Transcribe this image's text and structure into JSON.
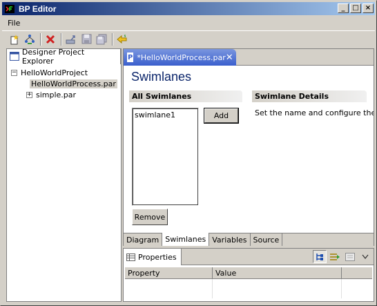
{
  "window": {
    "title": "BP Editor",
    "min": "_",
    "max": "□",
    "close": "×"
  },
  "menu": [
    "File"
  ],
  "explorer": {
    "tab_label": "Designer Project Explorer",
    "tree": {
      "project": "HelloWorldProject",
      "children": [
        "HelloWorldProcess.par",
        "simple.par"
      ]
    },
    "expand_minus": "−",
    "expand_plus": "+"
  },
  "editor": {
    "tab_label": "*HelloWorldProcess.par",
    "tab_close": "✕",
    "tab_icon": "P",
    "form_title": "Swimlanes",
    "all_swimlanes_header": "All Swimlanes",
    "details_header": "Swimlane Details",
    "swimlanes": [
      "swimlane1"
    ],
    "add_button": "Add",
    "remove_button": "Remove",
    "details_text": "Set the name and configure the a",
    "pages": [
      "Diagram",
      "Swimlanes",
      "Variables",
      "Source"
    ],
    "active_page": "Swimlanes"
  },
  "properties": {
    "tab_label": "Properties",
    "columns": [
      "Property",
      "Value"
    ]
  }
}
